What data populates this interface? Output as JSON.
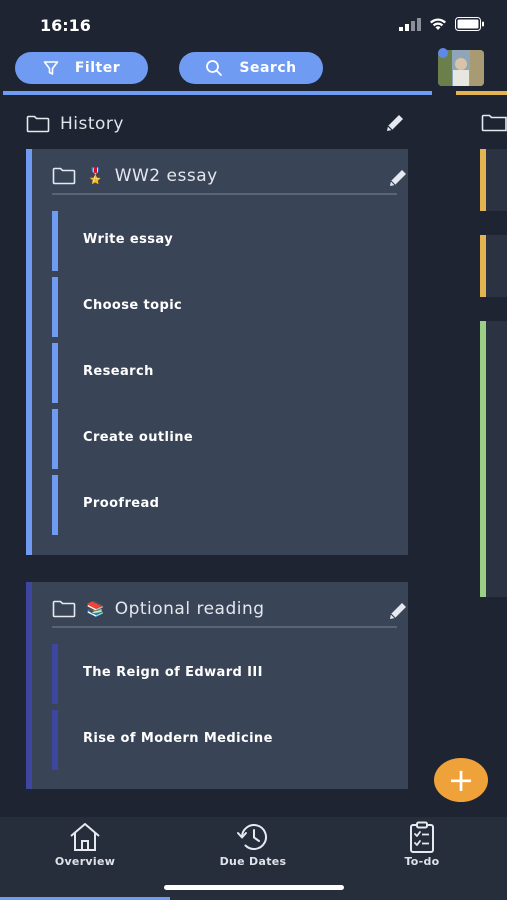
{
  "status": {
    "time": "16:16"
  },
  "toolbar": {
    "filter_label": "Filter",
    "search_label": "Search"
  },
  "section": {
    "title": "History"
  },
  "cards": [
    {
      "emoji": "🎖️",
      "title": "WW2 essay",
      "accent": "#6f9bf2",
      "tasks": [
        "Write essay",
        "Choose topic",
        "Research",
        "Create outline",
        "Proofread"
      ]
    },
    {
      "emoji": "📚",
      "title": "Optional reading",
      "accent": "#3d47a0",
      "tasks": [
        "The Reign of Edward III",
        "Rise of Modern Medicine"
      ]
    }
  ],
  "fab": {
    "label": "+"
  },
  "nav": {
    "overview": "Overview",
    "due_dates": "Due Dates",
    "todo": "To-do"
  },
  "colors": {
    "primary": "#6f9bf2",
    "secondary": "#e3b44f",
    "green": "#9ccf86",
    "fab": "#f0a23a"
  }
}
